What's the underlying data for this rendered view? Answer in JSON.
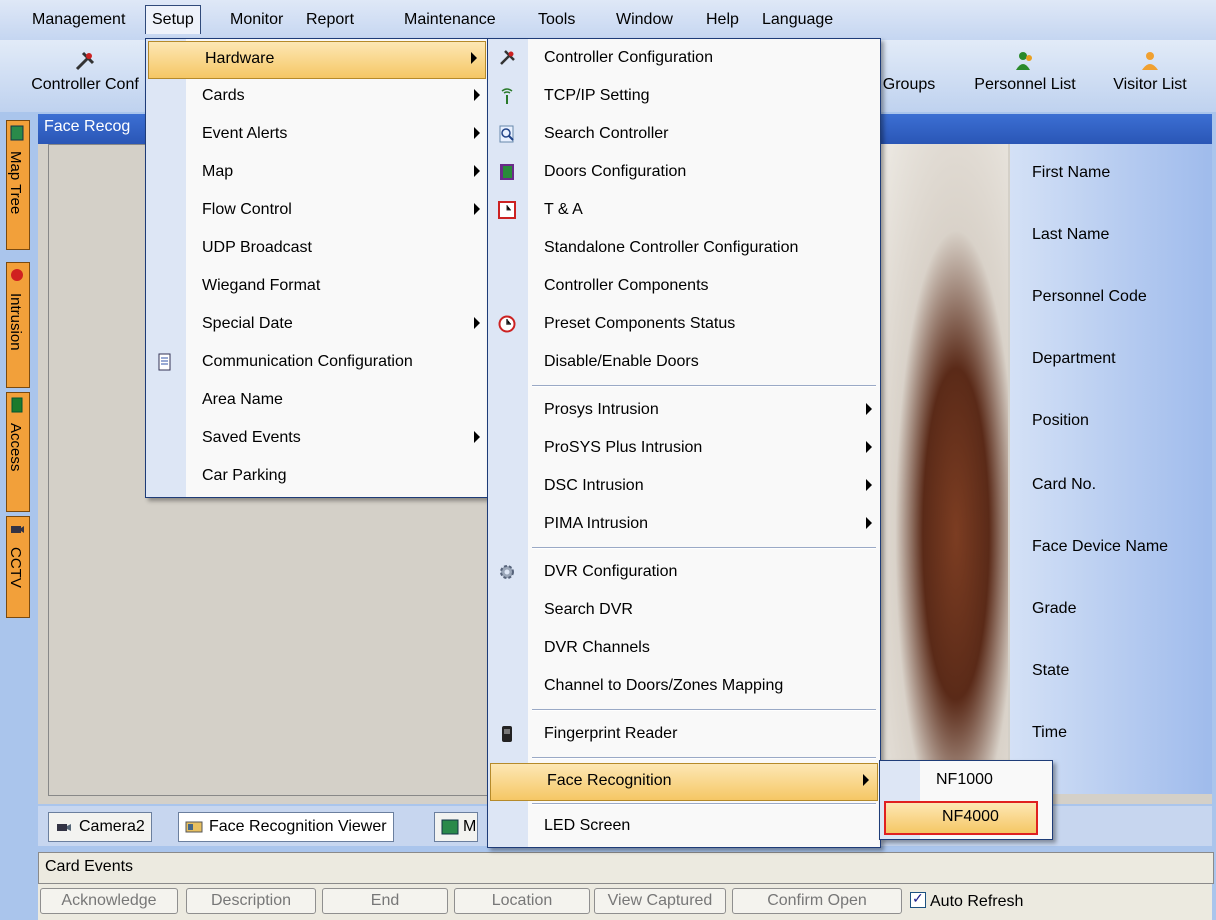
{
  "menubar": [
    "Management",
    "Setup",
    "Monitor",
    "Report",
    "Maintenance",
    "Tools",
    "Window",
    "Help",
    "Language"
  ],
  "toolbar": {
    "controller_config": "Controller Conf",
    "groups": "Groups",
    "personnel_list": "Personnel List",
    "visitor_list": "Visitor List"
  },
  "left_tabs": [
    "Map Tree",
    "Intrusion",
    "Access",
    "CCTV"
  ],
  "window": {
    "title": "Face Recog"
  },
  "info_fields": [
    "First Name",
    "Last Name",
    "Personnel Code",
    "Department",
    "Position",
    "Card No.",
    "Face Device Name",
    "Grade",
    "State",
    "Time"
  ],
  "setup_menu": [
    "Hardware",
    "Cards",
    "Event Alerts",
    "Map",
    "Flow Control",
    "UDP Broadcast",
    "Wiegand Format",
    "Special Date",
    "Communication Configuration",
    "Area Name",
    "Saved Events",
    "Car Parking"
  ],
  "hardware_menu": [
    "Controller Configuration",
    "TCP/IP Setting",
    "Search Controller",
    "Doors Configuration",
    "T & A",
    "Standalone Controller Configuration",
    "Controller Components",
    "Preset Components Status",
    "Disable/Enable Doors",
    "Prosys Intrusion",
    "ProSYS Plus Intrusion",
    "DSC Intrusion",
    "PIMA Intrusion",
    "DVR Configuration",
    "Search DVR",
    "DVR Channels",
    "Channel to Doors/Zones Mapping",
    "Fingerprint Reader",
    "Face Recognition",
    "LED Screen"
  ],
  "face_menu": [
    "NF1000",
    "NF4000"
  ],
  "bottom_tabs": [
    "Camera2",
    "Face Recognition Viewer",
    "M"
  ],
  "card_events": {
    "title": "Card Events"
  },
  "event_buttons": [
    "Acknowledge",
    "Description",
    "End",
    "Location",
    "View Captured",
    "Confirm Open"
  ],
  "auto_refresh": {
    "label": "Auto Refresh",
    "checked": true
  }
}
